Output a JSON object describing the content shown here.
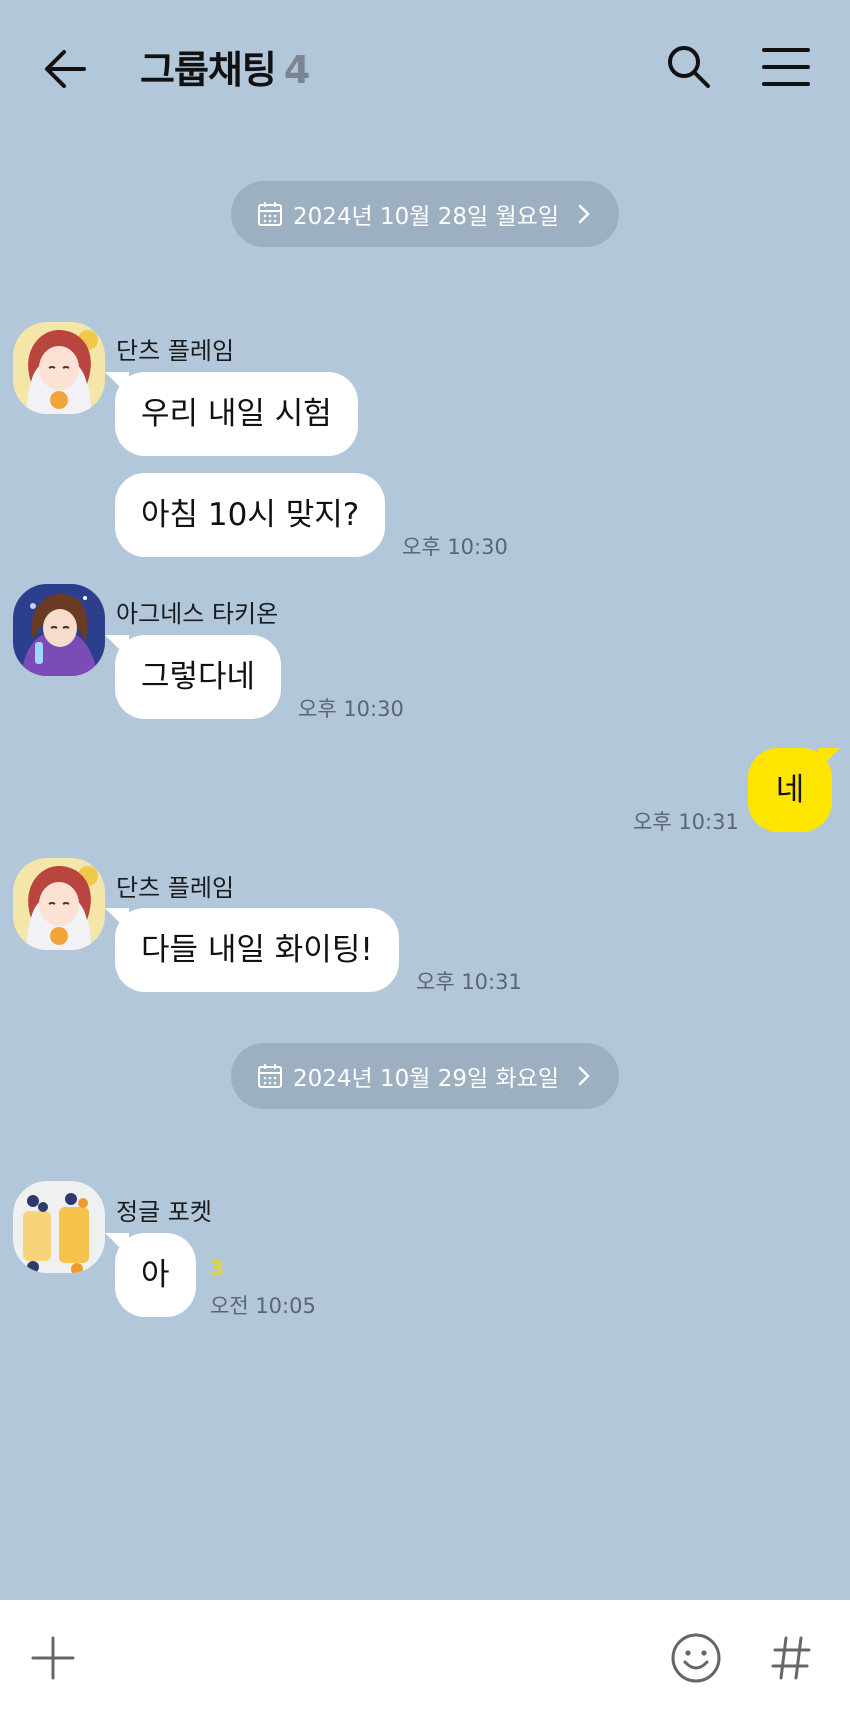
{
  "header": {
    "title": "그룹채팅",
    "member_count": "4",
    "back_icon": "arrow-left-icon",
    "search_icon": "search-icon",
    "menu_icon": "menu-icon"
  },
  "date_separators": [
    {
      "label": "2024년 10월 28일 월요일"
    },
    {
      "label": "2024년 10월 29일 화요일"
    }
  ],
  "messages": {
    "m1": {
      "sender": "단츠 플레임",
      "lines": [
        "우리 내일 시험",
        "아침 10시 맞지?"
      ],
      "time": "오후 10:30"
    },
    "m2": {
      "sender": "아그네스 타키온",
      "text": "그렇다네",
      "time": "오후 10:30"
    },
    "m3": {
      "sender": "me",
      "text": "네",
      "time": "오후 10:31"
    },
    "m4": {
      "sender": "단츠 플레임",
      "text": "다들 내일 화이팅!",
      "time": "오후 10:31"
    },
    "m5": {
      "sender": "정글 포켓",
      "text": "아",
      "unread": "3",
      "time": "오전 10:05"
    }
  },
  "bottom_bar": {
    "plus_icon": "plus-icon",
    "emoji_icon": "emoji-icon",
    "hash_icon": "hash-icon"
  },
  "colors": {
    "background": "#b2c7da",
    "my_bubble": "#fee500",
    "other_bubble": "#ffffff",
    "date_pill": "#9cb0c1",
    "unread": "#e3d53a"
  }
}
